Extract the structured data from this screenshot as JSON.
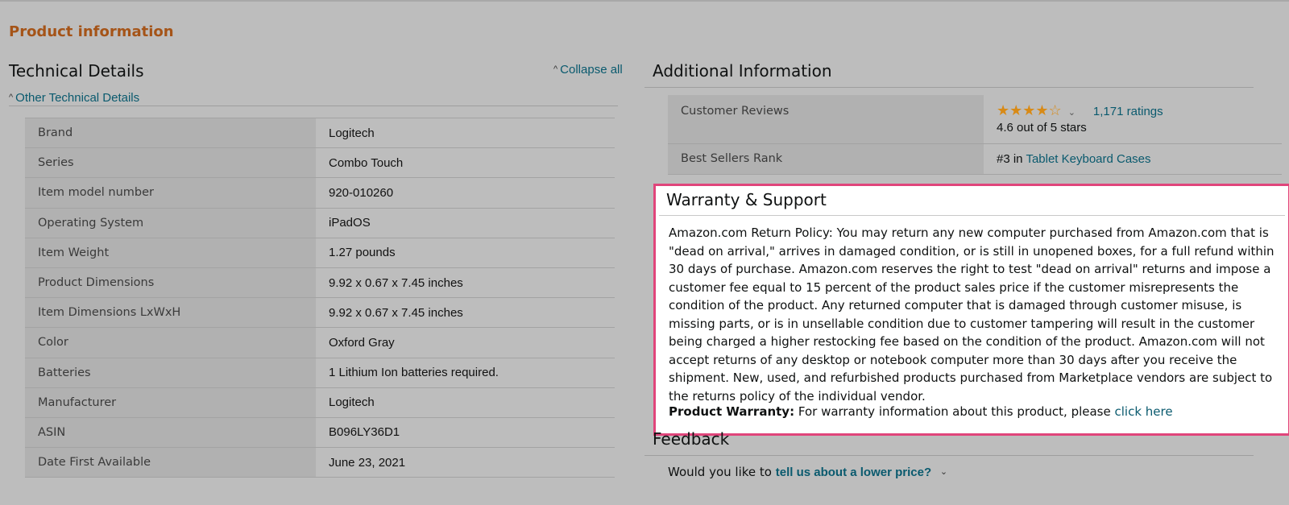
{
  "section_title": "Product information",
  "technical": {
    "heading": "Technical Details",
    "collapse_all": "Collapse all",
    "other_details": "Other Technical Details",
    "rows": [
      {
        "key": "Brand",
        "value": "Logitech"
      },
      {
        "key": "Series",
        "value": "Combo Touch"
      },
      {
        "key": "Item model number",
        "value": "920-010260"
      },
      {
        "key": "Operating System",
        "value": "iPadOS"
      },
      {
        "key": "Item Weight",
        "value": "1.27 pounds"
      },
      {
        "key": "Product Dimensions",
        "value": "9.92 x 0.67 x 7.45 inches"
      },
      {
        "key": "Item Dimensions LxWxH",
        "value": "9.92 x 0.67 x 7.45 inches"
      },
      {
        "key": "Color",
        "value": "Oxford Gray"
      },
      {
        "key": "Batteries",
        "value": "1 Lithium Ion batteries required."
      },
      {
        "key": "Manufacturer",
        "value": "Logitech"
      },
      {
        "key": "ASIN",
        "value": "B096LY36D1"
      },
      {
        "key": "Date First Available",
        "value": "June 23, 2021"
      }
    ]
  },
  "additional": {
    "heading": "Additional Information",
    "reviews_label": "Customer Reviews",
    "stars_glyphs": "★★★★☆",
    "rating_value": 4.6,
    "ratings_count": "1,171 ratings",
    "rating_text": "4.6 out of 5 stars",
    "rank_label": "Best Sellers Rank",
    "rank_prefix": "#3 in",
    "rank_category": "Tablet Keyboard Cases"
  },
  "warranty": {
    "heading": "Warranty & Support",
    "policy": "Amazon.com Return Policy:  You may return any new computer purchased from Amazon.com that is \"dead on arrival,\" arrives in damaged condition, or is still in unopened boxes, for a full refund within 30 days of purchase. Amazon.com reserves the right to test \"dead on arrival\" returns and impose a customer fee equal to 15 percent of the product sales price if the customer misrepresents the condition of the product. Any returned computer that is damaged through customer misuse, is missing parts, or is in unsellable condition due to customer tampering will result in the customer being charged a higher restocking fee based on the condition of the product. Amazon.com will not accept returns of any desktop or notebook computer more than 30 days after you receive the shipment. New, used, and refurbished products purchased from Marketplace vendors are subject to the returns policy of the individual vendor.",
    "product_warranty_label": "Product Warranty:",
    "product_warranty_text": "For warranty information about this product, please",
    "click_here": "click here"
  },
  "feedback": {
    "heading": "Feedback",
    "question": "Would you like to",
    "link": "tell us about a lower price?"
  },
  "colors": {
    "section_title": "#a55418",
    "link": "#0a5a6e",
    "highlight_border": "#e0457b",
    "star": "#d88a16"
  }
}
